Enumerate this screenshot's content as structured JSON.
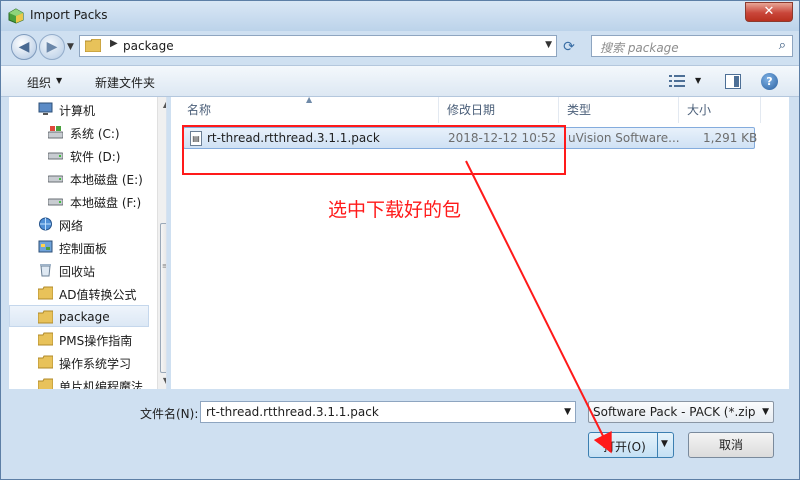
{
  "window": {
    "title": "Import Packs",
    "close_label": "✕"
  },
  "nav": {
    "address_path": "package",
    "search_placeholder": "搜索 package"
  },
  "toolbar": {
    "organize_label": "组织",
    "new_folder_label": "新建文件夹"
  },
  "sidebar": {
    "items": [
      {
        "label": "计算机",
        "icon": "computer-icon"
      },
      {
        "label": "系统 (C:)",
        "icon": "system-drive-icon"
      },
      {
        "label": "软件 (D:)",
        "icon": "drive-icon"
      },
      {
        "label": "本地磁盘 (E:)",
        "icon": "drive-icon"
      },
      {
        "label": "本地磁盘 (F:)",
        "icon": "drive-icon"
      },
      {
        "label": "网络",
        "icon": "network-icon"
      },
      {
        "label": "控制面板",
        "icon": "control-panel-icon"
      },
      {
        "label": "回收站",
        "icon": "recycle-bin-icon"
      },
      {
        "label": "AD值转换公式",
        "icon": "folder-icon"
      },
      {
        "label": "package",
        "icon": "folder-icon"
      },
      {
        "label": "PMS操作指南",
        "icon": "folder-icon"
      },
      {
        "label": "操作系统学习",
        "icon": "folder-icon"
      },
      {
        "label": "单片机编程魔法",
        "icon": "folder-icon"
      }
    ],
    "selected_label": "package"
  },
  "columns": {
    "name": "名称",
    "modified": "修改日期",
    "type": "类型",
    "size": "大小"
  },
  "files": [
    {
      "name": "rt-thread.rtthread.3.1.1.pack",
      "modified": "2018-12-12 10:52",
      "type": "uVision Software...",
      "size": "1,291 KB"
    }
  ],
  "annotation": {
    "text": "选中下载好的包",
    "color": "#ff1a1a"
  },
  "bottom": {
    "filename_label": "文件名(N):",
    "filename_value": "rt-thread.rtthread.3.1.1.pack",
    "filetype_value": "Software Pack - PACK (*.zip;*",
    "open_label": "打开(O)",
    "cancel_label": "取消"
  }
}
